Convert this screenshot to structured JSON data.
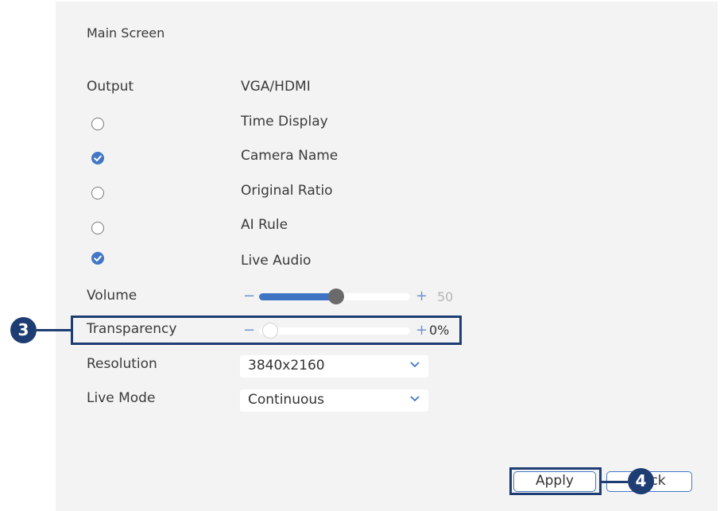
{
  "section": {
    "title": "Main Screen"
  },
  "output": {
    "label": "Output",
    "value": "VGA/HDMI"
  },
  "options": [
    {
      "label": "Time Display",
      "checked": false
    },
    {
      "label": "Camera Name",
      "checked": true
    },
    {
      "label": "Original Ratio",
      "checked": false
    },
    {
      "label": "AI Rule",
      "checked": false
    },
    {
      "label": "Live Audio",
      "checked": true
    }
  ],
  "volume": {
    "label": "Volume",
    "minus": "−",
    "plus": "+",
    "value": "50",
    "level": 0.49
  },
  "transparency": {
    "label": "Transparency",
    "minus": "−",
    "plus": "+",
    "value": "0%",
    "level": 0.0
  },
  "resolution": {
    "label": "Resolution",
    "value": "3840x2160"
  },
  "live_mode": {
    "label": "Live Mode",
    "value": "Continuous"
  },
  "buttons": {
    "apply": "Apply",
    "back": "Back"
  },
  "callouts": {
    "transparency": "3",
    "apply": "4"
  },
  "colors": {
    "accent": "#4277c4",
    "callout": "#1e3d73",
    "panel": "#f3f3f3"
  }
}
